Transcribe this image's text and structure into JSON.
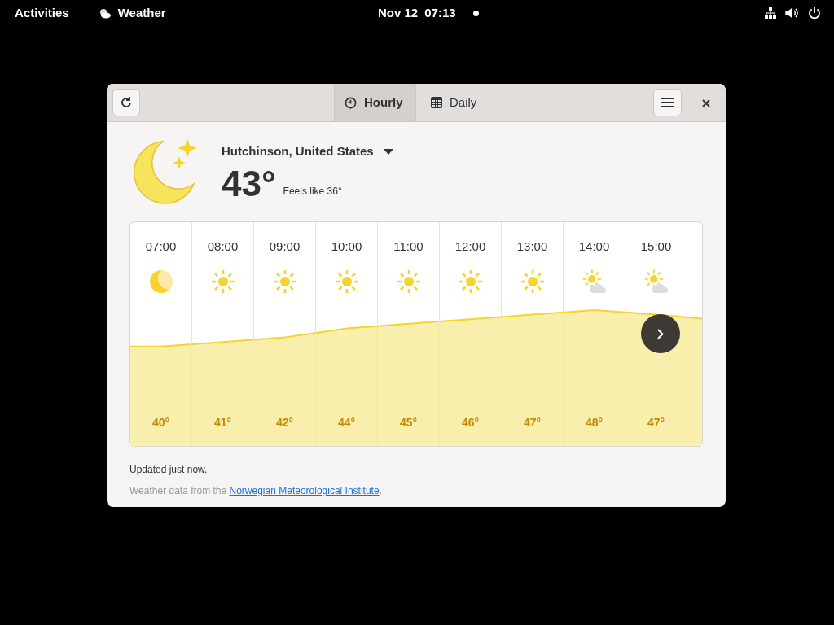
{
  "top_bar": {
    "activities": "Activities",
    "app_name": "Weather",
    "date": "Nov 12",
    "time": "07:13"
  },
  "window": {
    "tabs": [
      {
        "label": "Hourly",
        "kind": "clock",
        "selected": true
      },
      {
        "label": "Daily",
        "kind": "calendar",
        "selected": false
      }
    ]
  },
  "current": {
    "location": "Hutchinson, United States",
    "temperature": "43°",
    "feels_like": "Feels like 36°"
  },
  "hours": [
    {
      "time": "07:00",
      "kind": "moon",
      "temperature": "40°"
    },
    {
      "time": "08:00",
      "kind": "sun",
      "temperature": "41°"
    },
    {
      "time": "09:00",
      "kind": "sun",
      "temperature": "42°"
    },
    {
      "time": "10:00",
      "kind": "sun",
      "temperature": "44°"
    },
    {
      "time": "11:00",
      "kind": "sun",
      "temperature": "45°"
    },
    {
      "time": "12:00",
      "kind": "sun",
      "temperature": "46°"
    },
    {
      "time": "13:00",
      "kind": "sun",
      "temperature": "47°"
    },
    {
      "time": "14:00",
      "kind": "cloudy",
      "temperature": "48°"
    },
    {
      "time": "15:00",
      "kind": "cloudy",
      "temperature": "47°"
    }
  ],
  "footer": {
    "updated": "Updated just now.",
    "attribution_prefix": "Weather data from the ",
    "attribution_link": "Norwegian Meteorological Institute",
    "attribution_suffix": "."
  }
}
